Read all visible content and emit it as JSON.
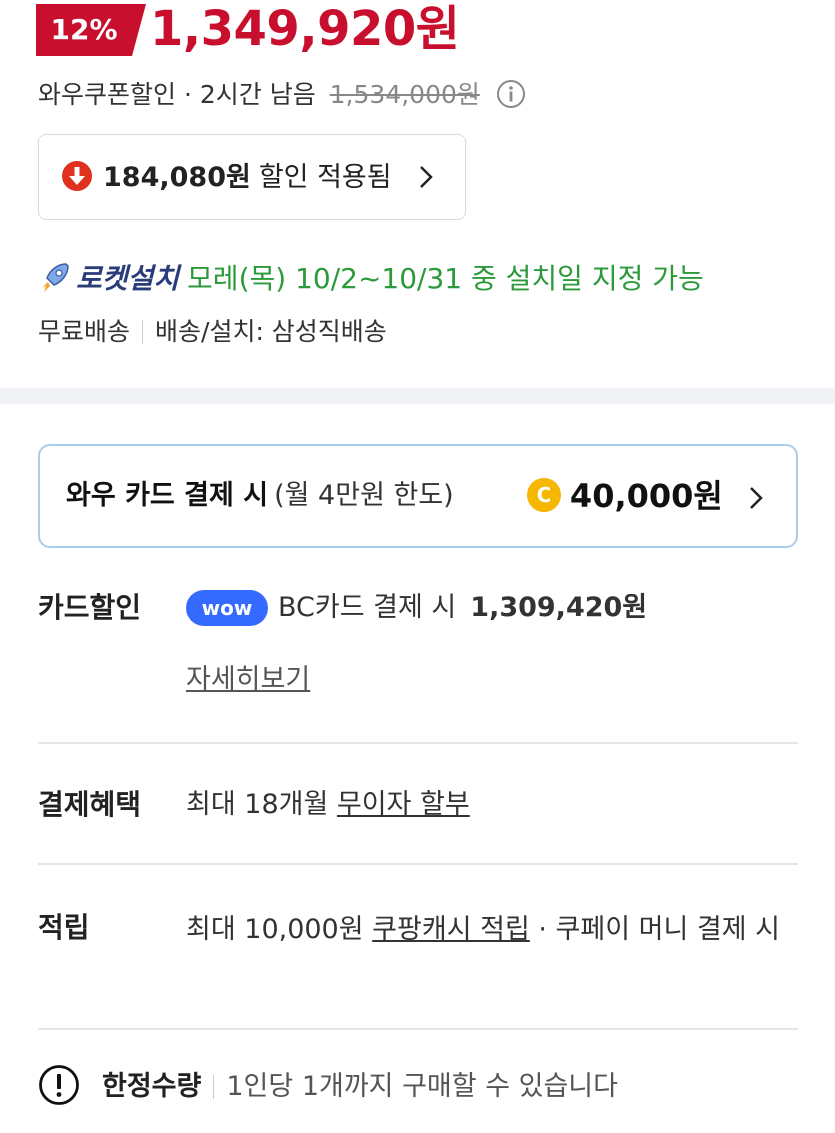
{
  "price": {
    "discount_rate": "12%",
    "sale_price": "1,349,920원",
    "coupon_label": "와우쿠폰할인 · 2시간 남음",
    "original_price": "1,534,000원",
    "accent_color": "#c8102e"
  },
  "discount_box": {
    "amount": "184,080원",
    "label": "할인 적용됨",
    "icon": "down-arrow-circle-icon"
  },
  "delivery": {
    "brand": "로켓설치",
    "schedule": "모레(목) 10/2~10/31 중 설치일 지정 가능",
    "free_shipping": "무료배송",
    "installer": "배송/설치: 삼성직배송"
  },
  "wow_card": {
    "title": "와우 카드 결제 시",
    "limit": "(월 4만원 한도)",
    "reward": "40,000원",
    "coin_icon_letter": "C"
  },
  "benefits": {
    "card_discount": {
      "label": "카드할인",
      "badge": "wow",
      "text": "BC카드 결제 시",
      "amount": "1,309,420원",
      "link": "자세히보기"
    },
    "payment": {
      "label": "결제혜택",
      "prefix": "최대 18개월",
      "link": "무이자 할부"
    },
    "points": {
      "label": "적립",
      "prefix": "최대 10,000원",
      "link": "쿠팡캐시 적립",
      "suffix": "· 쿠페이 머니 결제 시"
    }
  },
  "limit": {
    "label": "한정수량",
    "text": "1인당 1개까지 구매할 수 있습니다"
  }
}
